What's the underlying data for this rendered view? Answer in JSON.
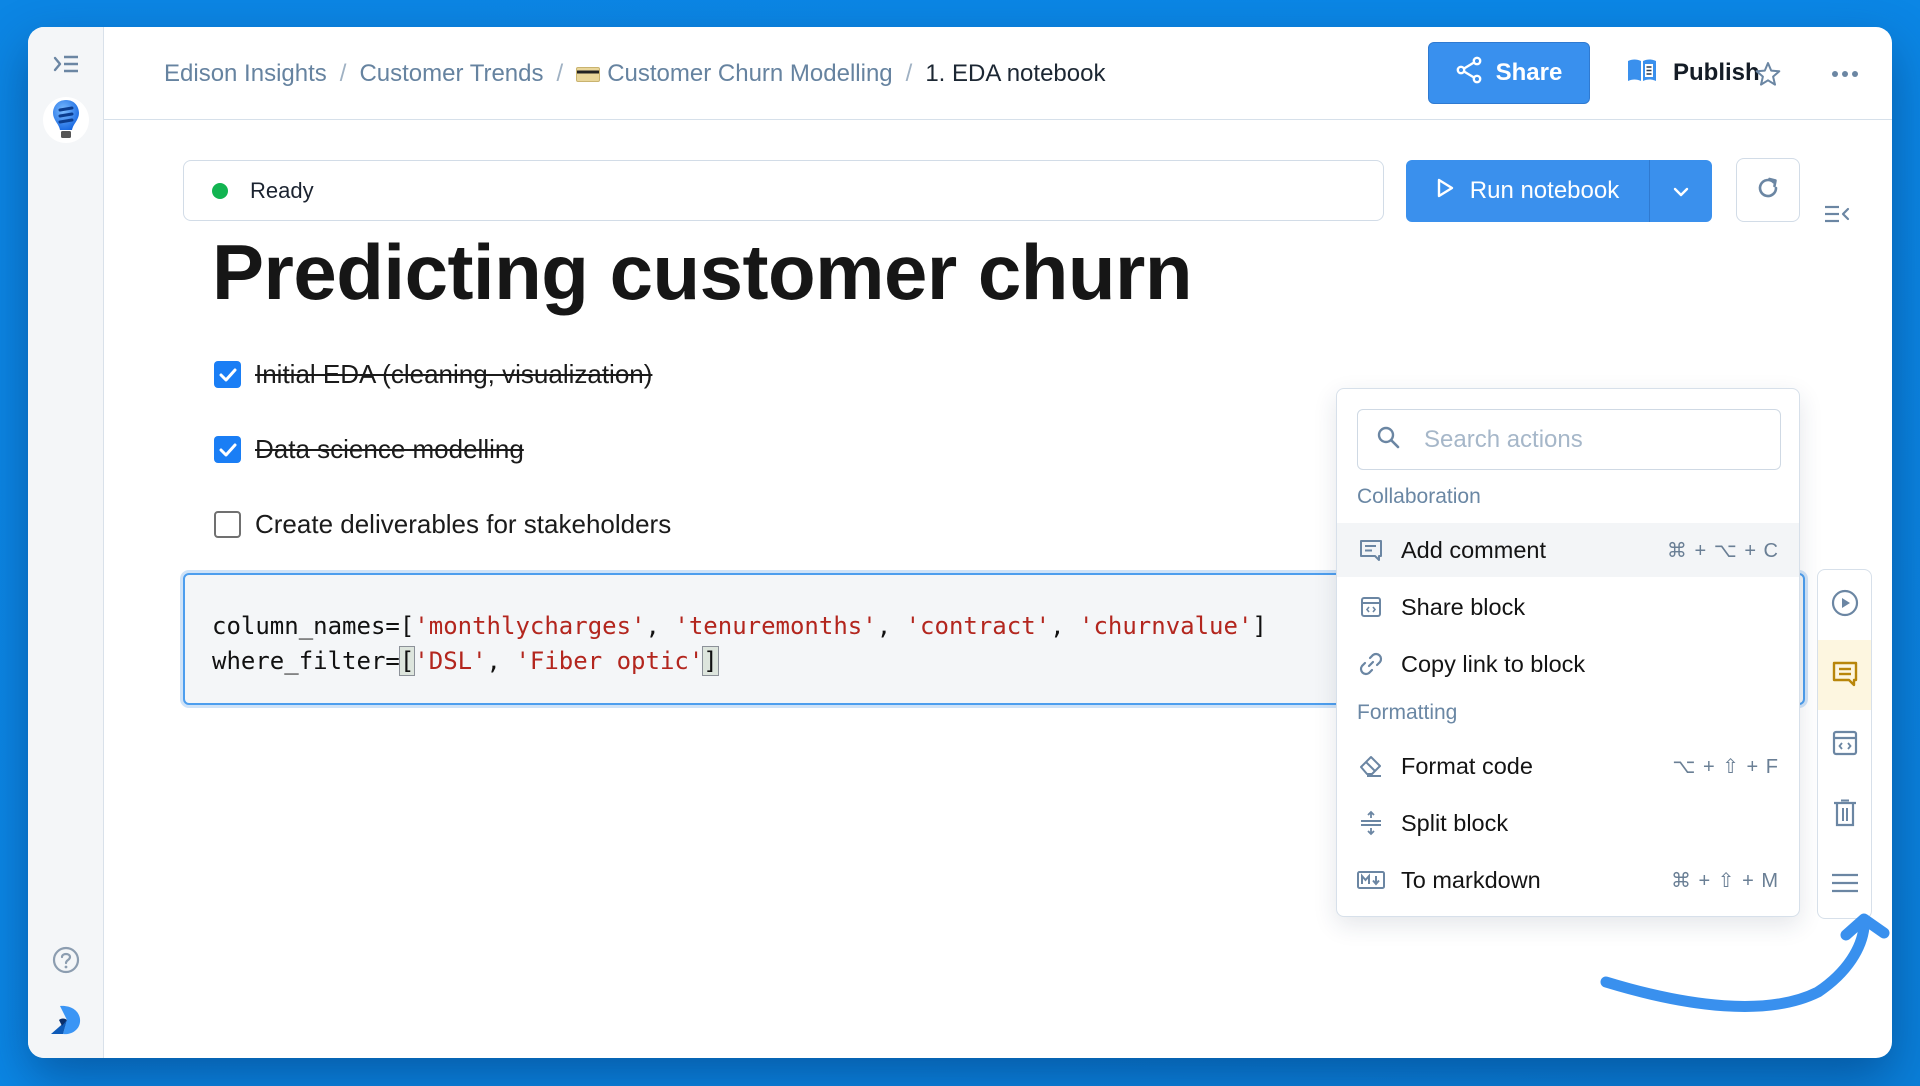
{
  "breadcrumb": {
    "items": [
      "Edison Insights",
      "Customer Trends",
      "Customer Churn Modelling"
    ],
    "current": "1. EDA notebook",
    "separator": "/"
  },
  "header": {
    "share_label": "Share",
    "publish_label": "Publish"
  },
  "toolbar": {
    "status": "Ready",
    "status_color": "#12b451",
    "run_label": "Run notebook"
  },
  "notebook": {
    "title": "Predicting customer churn",
    "todos": [
      {
        "label": "Initial EDA (cleaning, visualization)",
        "checked": true
      },
      {
        "label": "Data science modelling",
        "checked": true
      },
      {
        "label": "Create deliverables for stakeholders",
        "checked": false
      }
    ],
    "code": {
      "line1_var": "column_names=[",
      "line1_strings": [
        "'monthlycharges'",
        "'tenuremonths'",
        "'contract'",
        "'churnvalue'"
      ],
      "line1_end": "]",
      "line2_var": "where_filter=",
      "line2_strings": [
        "'DSL'",
        "'Fiber optic'"
      ]
    }
  },
  "actions_menu": {
    "search_placeholder": "Search actions",
    "sections": [
      {
        "title": "Collaboration",
        "items": [
          {
            "label": "Add comment",
            "shortcut": "⌘ + ⌥ + C",
            "icon": "comment-icon"
          },
          {
            "label": "Share block",
            "shortcut": "",
            "icon": "embed-icon"
          },
          {
            "label": "Copy link to block",
            "shortcut": "",
            "icon": "link-icon"
          }
        ]
      },
      {
        "title": "Formatting",
        "items": [
          {
            "label": "Format code",
            "shortcut": "⌥ + ⇧ + F",
            "icon": "eraser-icon"
          },
          {
            "label": "Split block",
            "shortcut": "",
            "icon": "split-icon"
          },
          {
            "label": "To markdown",
            "shortcut": "⌘ + ⇧ + M",
            "icon": "markdown-icon"
          }
        ]
      }
    ]
  },
  "block_rail": {
    "buttons": [
      "run-block",
      "comment",
      "share-block",
      "delete-block",
      "more-actions"
    ],
    "active": "comment"
  },
  "colors": {
    "accent": "#3a90ed",
    "background": "#0c86e4",
    "string": "#b3261e",
    "comment_active": "#b8860b"
  }
}
